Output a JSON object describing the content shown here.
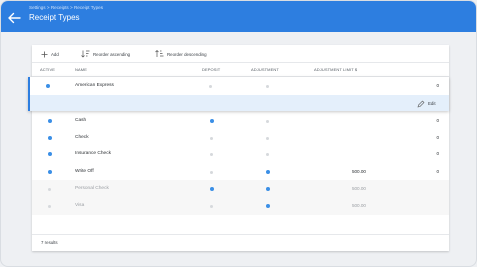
{
  "header": {
    "breadcrumb": [
      "Settings",
      "Receipts",
      "Receipt Types"
    ],
    "breadcrumb_separator": ">",
    "title": "Receipt Types",
    "bg_color": "#2d7ee0"
  },
  "toolbar": {
    "add_label": "Add",
    "reorder_asc_label": "Reorder ascending",
    "reorder_desc_label": "Reorder descending"
  },
  "table": {
    "columns": [
      "ACTIVE",
      "NAME",
      "DEPOSIT",
      "ADJUSTMENT",
      "ADJUSTMENT LIMIT $"
    ],
    "rows": [
      {
        "active": true,
        "name": "American Express",
        "deposit": false,
        "adjustment": false,
        "limit": "",
        "trailing": "0",
        "selected": true
      },
      {
        "active": true,
        "name": "Cash",
        "deposit": true,
        "adjustment": false,
        "limit": "",
        "trailing": "0"
      },
      {
        "active": true,
        "name": "Check",
        "deposit": false,
        "adjustment": false,
        "limit": "",
        "trailing": "0"
      },
      {
        "active": true,
        "name": "Insurance Check",
        "deposit": false,
        "adjustment": false,
        "limit": "",
        "trailing": "0"
      },
      {
        "active": true,
        "name": "Write Off",
        "deposit": false,
        "adjustment": true,
        "limit": "500.00",
        "trailing": "0"
      },
      {
        "active": false,
        "name": "Personal Check",
        "deposit": true,
        "adjustment": true,
        "limit": "500.00",
        "trailing": ""
      },
      {
        "active": false,
        "name": "Visa",
        "deposit": false,
        "adjustment": true,
        "limit": "500.00",
        "trailing": ""
      }
    ],
    "edit_label": "Edit"
  },
  "footer": {
    "results_text": "7 results"
  },
  "colors": {
    "accent": "#2d7ee0",
    "dot_on": "#3b8fe6",
    "dot_off": "#d6d9dc"
  }
}
